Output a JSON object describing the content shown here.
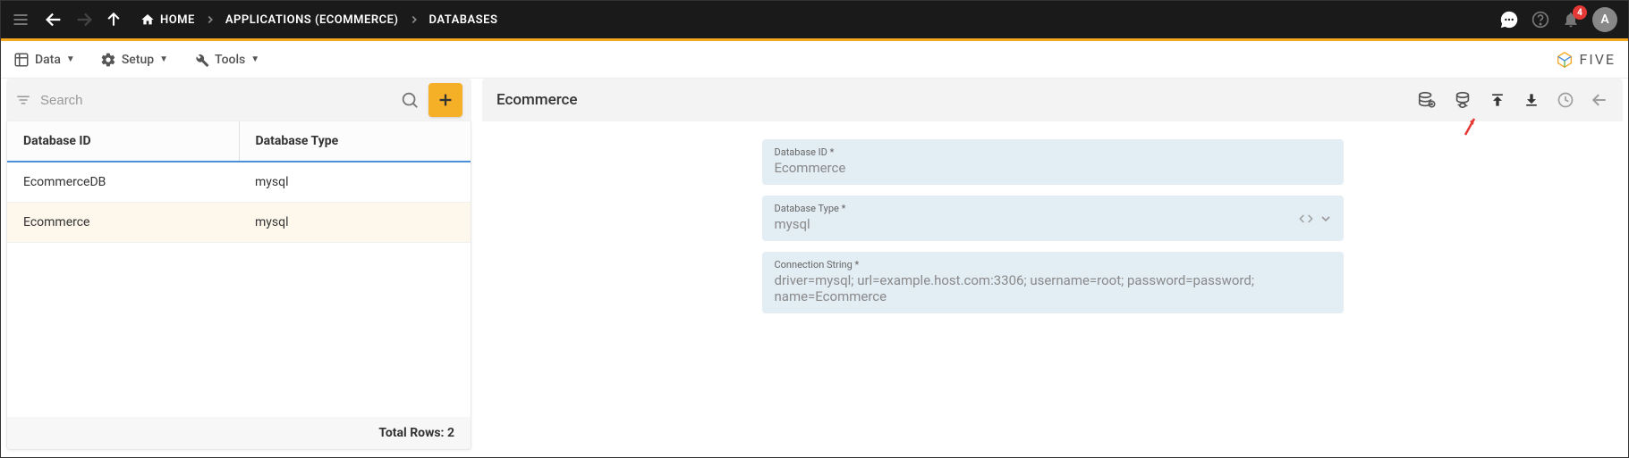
{
  "header": {
    "breadcrumbs": [
      "HOME",
      "APPLICATIONS (ECOMMERCE)",
      "DATABASES"
    ],
    "notification_count": "4",
    "avatar_letter": "A"
  },
  "menubar": {
    "items": [
      {
        "label": "Data"
      },
      {
        "label": "Setup"
      },
      {
        "label": "Tools"
      }
    ],
    "brand": "FIVE"
  },
  "list_panel": {
    "search_placeholder": "Search",
    "columns": [
      "Database ID",
      "Database Type"
    ],
    "rows": [
      {
        "id": "EcommerceDB",
        "type": "mysql",
        "selected": false
      },
      {
        "id": "Ecommerce",
        "type": "mysql",
        "selected": true
      }
    ],
    "footer": "Total Rows: 2"
  },
  "detail_panel": {
    "title": "Ecommerce",
    "fields": [
      {
        "label": "Database ID *",
        "value": "Ecommerce",
        "has_suffix": false
      },
      {
        "label": "Database Type *",
        "value": "mysql",
        "has_suffix": true
      },
      {
        "label": "Connection String *",
        "value": "driver=mysql; url=example.host.com:3306; username=root; password=password; name=Ecommerce",
        "has_suffix": false
      }
    ]
  }
}
